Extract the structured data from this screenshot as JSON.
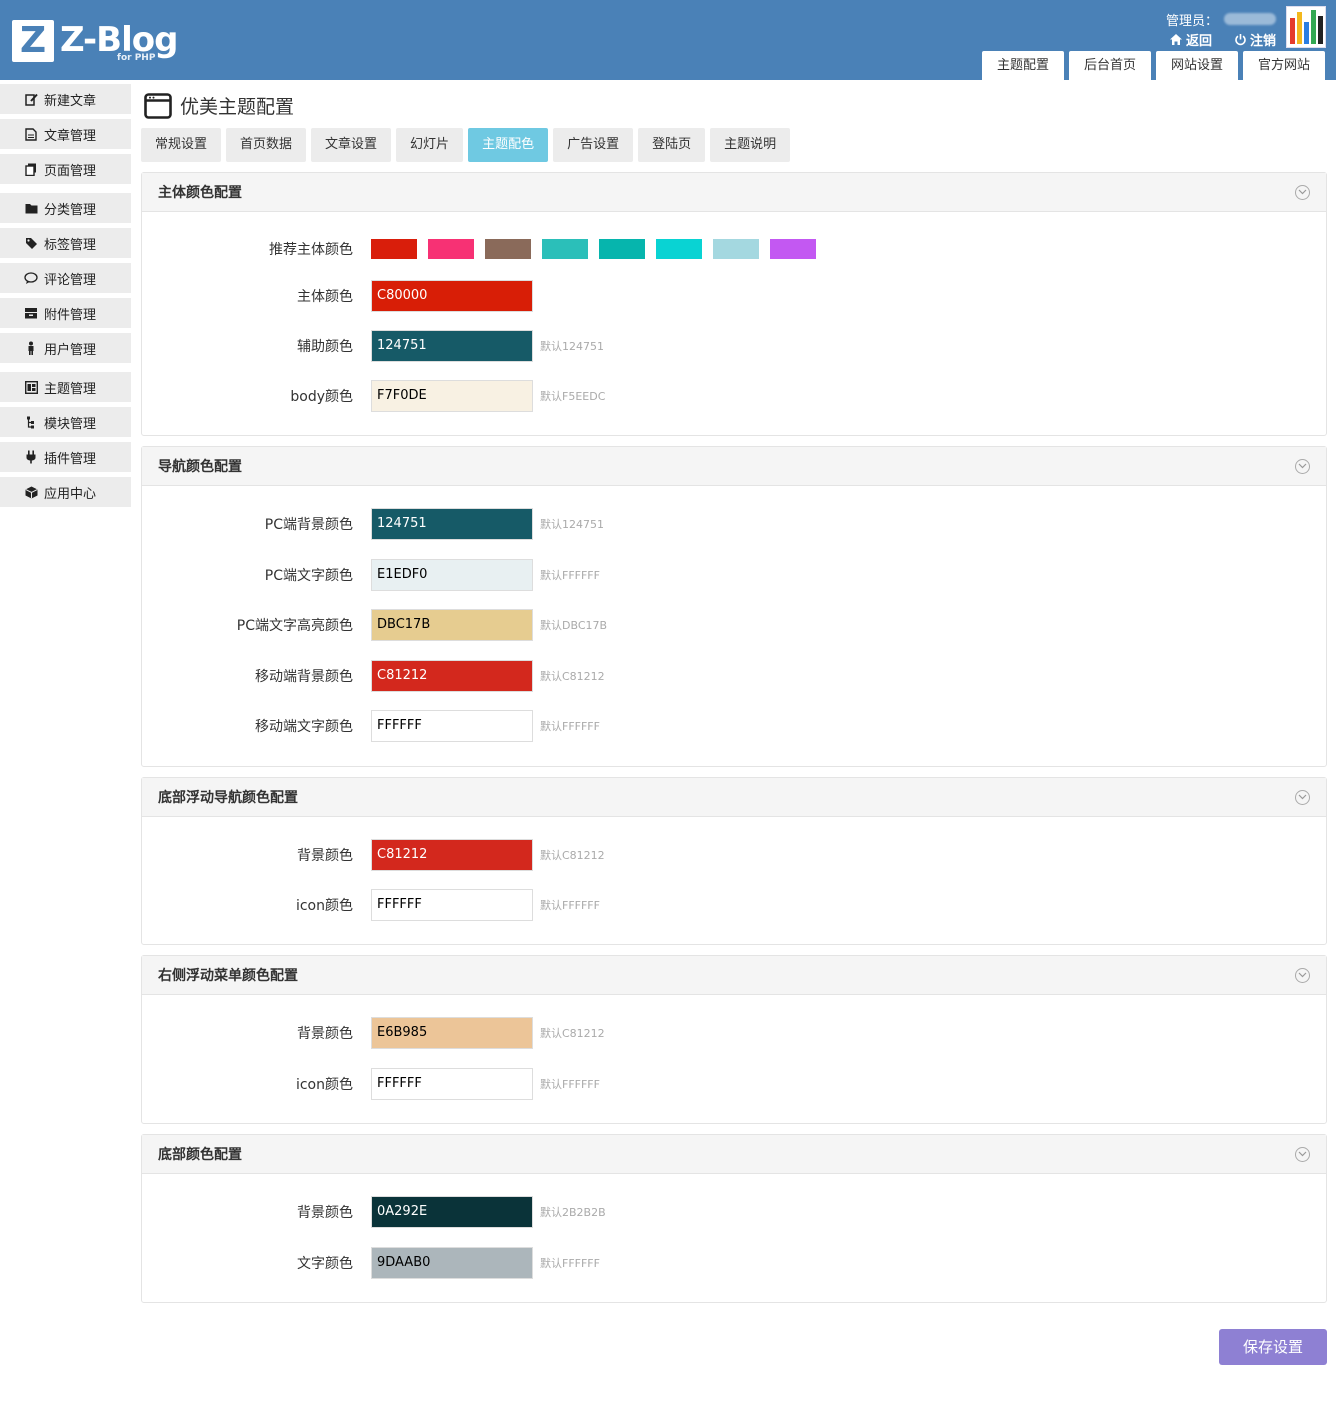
{
  "header": {
    "logo_letter": "Z",
    "logo_text": "Z-Blog",
    "logo_sub": "for PHP",
    "admin_label": "管理员：",
    "back_label": "返回",
    "logout_label": "注销",
    "tabs": [
      "主题配置",
      "后台首页",
      "网站设置",
      "官方网站"
    ]
  },
  "sidebar": {
    "items": [
      {
        "label": "新建文章",
        "icon": "edit-icon"
      },
      {
        "label": "文章管理",
        "icon": "document-icon"
      },
      {
        "label": "页面管理",
        "icon": "pages-icon"
      },
      {
        "label": "分类管理",
        "icon": "folder-icon"
      },
      {
        "label": "标签管理",
        "icon": "tag-icon"
      },
      {
        "label": "评论管理",
        "icon": "comment-icon"
      },
      {
        "label": "附件管理",
        "icon": "archive-icon"
      },
      {
        "label": "用户管理",
        "icon": "user-icon"
      },
      {
        "label": "主题管理",
        "icon": "theme-icon"
      },
      {
        "label": "模块管理",
        "icon": "module-icon"
      },
      {
        "label": "插件管理",
        "icon": "plugin-icon"
      },
      {
        "label": "应用中心",
        "icon": "box-icon"
      }
    ]
  },
  "page": {
    "title": "优美主题配置",
    "tabs": [
      "常规设置",
      "首页数据",
      "文章设置",
      "幻灯片",
      "主题配色",
      "广告设置",
      "登陆页",
      "主题说明"
    ],
    "active_tab": "主题配色"
  },
  "panels": {
    "main": {
      "title": "主体颜色配置",
      "swatch_label": "推荐主体颜色",
      "swatches": [
        "#d91e0b",
        "#f73174",
        "#8a6a5a",
        "#2bbfb9",
        "#06b5ad",
        "#09d3d3",
        "#a4d8e0",
        "#c358f2"
      ],
      "rows": [
        {
          "label": "主体颜色",
          "value": "C80000",
          "bg": "#d81e06",
          "fg": "#ffffff",
          "hint": ""
        },
        {
          "label": "辅助颜色",
          "value": "124751",
          "bg": "#165a67",
          "fg": "#ffffff",
          "hint": "默认124751"
        },
        {
          "label": "body颜色",
          "value": "F7F0DE",
          "bg": "#f8f1e3",
          "fg": "#000000",
          "hint": "默认F5EEDC"
        }
      ]
    },
    "nav": {
      "title": "导航颜色配置",
      "rows": [
        {
          "label": "PC端背景颜色",
          "value": "124751",
          "bg": "#165a67",
          "fg": "#ffffff",
          "hint": "默认124751"
        },
        {
          "label": "PC端文字颜色",
          "value": "E1EDF0",
          "bg": "#e8f0f2",
          "fg": "#000000",
          "hint": "默认FFFFFF"
        },
        {
          "label": "PC端文字高亮颜色",
          "value": "DBC17B",
          "bg": "#e6cc90",
          "fg": "#000000",
          "hint": "默认DBC17B"
        },
        {
          "label": "移动端背景颜色",
          "value": "C81212",
          "bg": "#d3281d",
          "fg": "#ffffff",
          "hint": "默认C81212"
        },
        {
          "label": "移动端文字颜色",
          "value": "FFFFFF",
          "bg": "#ffffff",
          "fg": "#000000",
          "hint": "默认FFFFFF"
        }
      ]
    },
    "bottom_nav": {
      "title": "底部浮动导航颜色配置",
      "rows": [
        {
          "label": "背景颜色",
          "value": "C81212",
          "bg": "#d3281d",
          "fg": "#ffffff",
          "hint": "默认C81212"
        },
        {
          "label": "icon颜色",
          "value": "FFFFFF",
          "bg": "#ffffff",
          "fg": "#000000",
          "hint": "默认FFFFFF"
        }
      ]
    },
    "right_menu": {
      "title": "右侧浮动菜单颜色配置",
      "rows": [
        {
          "label": "背景颜色",
          "value": "E6B985",
          "bg": "#ecc598",
          "fg": "#000000",
          "hint": "默认C81212"
        },
        {
          "label": "icon颜色",
          "value": "FFFFFF",
          "bg": "#ffffff",
          "fg": "#000000",
          "hint": "默认FFFFFF"
        }
      ]
    },
    "footer": {
      "title": "底部颜色配置",
      "rows": [
        {
          "label": "背景颜色",
          "value": "0A292E",
          "bg": "#0a3339",
          "fg": "#ffffff",
          "hint": "默认2B2B2B"
        },
        {
          "label": "文字颜色",
          "value": "9DAAB0",
          "bg": "#acb6bb",
          "fg": "#000000",
          "hint": "默认FFFFFF"
        }
      ]
    }
  },
  "save_label": "保存设置",
  "colors": {
    "header_bg": "#4a81b7",
    "active_tab": "#6fc9e2",
    "save_button": "#8e80d3"
  }
}
